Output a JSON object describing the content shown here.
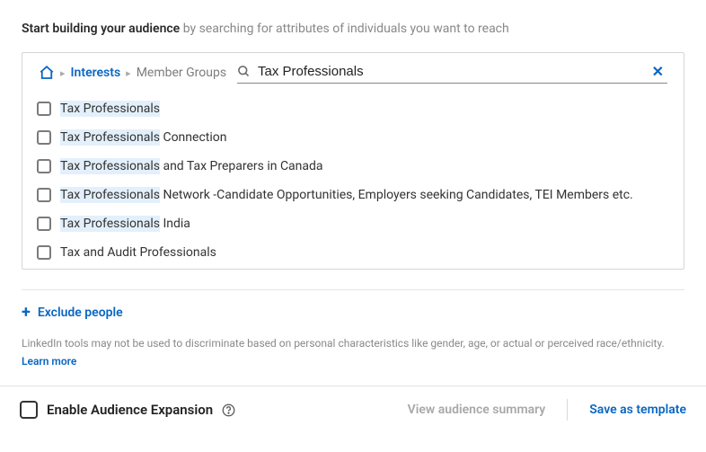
{
  "heading": {
    "bold": "Start building your audience",
    "rest": " by searching for attributes of individuals you want to reach"
  },
  "breadcrumb": {
    "level1": "Interests",
    "level2": "Member Groups"
  },
  "search": {
    "value": "Tax Professionals",
    "placeholder": ""
  },
  "results": [
    {
      "hl": "Tax Professionals",
      "rest": ""
    },
    {
      "hl": "Tax Professionals",
      "rest": " Connection"
    },
    {
      "hl": "Tax Professionals",
      "rest": " and Tax Preparers in Canada"
    },
    {
      "hl": "Tax Professionals",
      "rest": " Network -Candidate Opportunities, Employers seeking Candidates, TEI Members etc."
    },
    {
      "hl": "Tax Professionals",
      "rest": " India"
    },
    {
      "hl": "",
      "rest": "Tax and Audit Professionals"
    }
  ],
  "exclude": {
    "label": "Exclude people"
  },
  "disclaimer": {
    "text": "LinkedIn tools may not be used to discriminate based on personal characteristics like gender, age, or actual or perceived race/ethnicity.",
    "learn": "Learn more"
  },
  "footer": {
    "enable_label": "Enable Audience Expansion",
    "view_summary": "View audience summary",
    "save_template": "Save as template"
  }
}
